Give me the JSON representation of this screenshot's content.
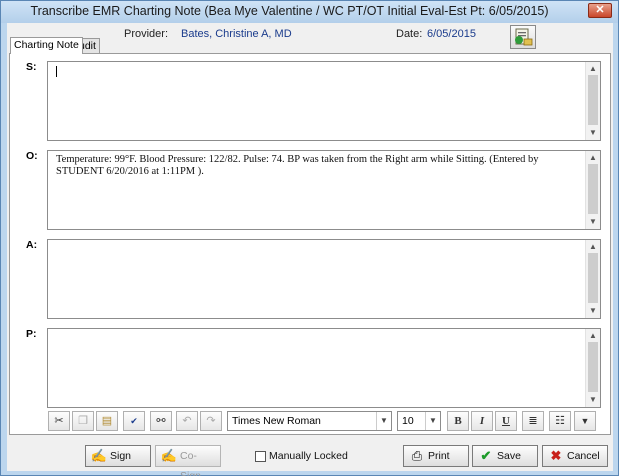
{
  "window": {
    "title": "Transcribe EMR Charting Note (Bea Mye Valentine / WC PT/OT  Initial Eval-Est Pt:  6/05/2015)",
    "close_glyph": "✕"
  },
  "header": {
    "provider_label": "Provider:",
    "provider_value": "Bates, Christine A, MD",
    "date_label": "Date:",
    "date_value": "6/05/2015"
  },
  "tabs": [
    {
      "label": "Charting Note",
      "active": true
    },
    {
      "label": "Audit",
      "active": false
    }
  ],
  "sections": {
    "s": {
      "label": "S:",
      "text": ""
    },
    "o": {
      "label": "O:",
      "text": "Temperature: 99°F. Blood Pressure: 122/82. Pulse: 74. BP was taken from the Right arm while Sitting. (Entered by STUDENT 6/20/2016 at  1:11PM )."
    },
    "a": {
      "label": "A:",
      "text": ""
    },
    "p": {
      "label": "P:",
      "text": ""
    }
  },
  "toolbar": {
    "font_name": "Times New Roman",
    "font_size": "10",
    "bold_label": "B",
    "italic_label": "I",
    "underline_label": "U"
  },
  "bottom": {
    "sign_label": "Sign",
    "cosign_label": "Co-Sign",
    "manually_locked_label": "Manually Locked",
    "print_label": "Print",
    "save_label": "Save",
    "cancel_label": "Cancel"
  },
  "icons": {
    "cut": "cut-icon",
    "copy": "copy-icon",
    "paste": "paste-icon",
    "spellcheck": "spellcheck-icon",
    "find": "binoculars-icon",
    "undo": "undo-icon",
    "redo": "redo-icon",
    "align": "align-icon",
    "bullets": "bullet-list-icon"
  },
  "colors": {
    "save_check": "#1d9b2a",
    "cancel_x": "#c8201a",
    "link_text": "#1a3b8c"
  }
}
